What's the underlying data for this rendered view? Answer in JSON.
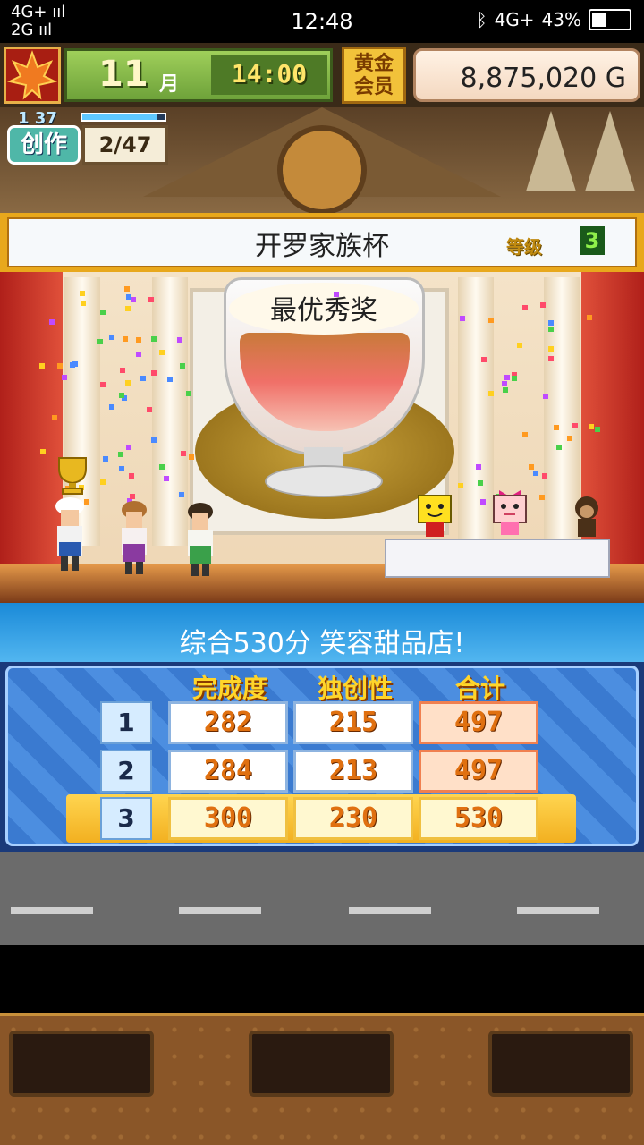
{
  "status_bar": {
    "network_line1": "4G+ ııl",
    "network_line2": "2G ııl",
    "time": "12:48",
    "bluetooth": "bluetooth-icon",
    "network_right": "4G+",
    "battery": "43%",
    "battery_level": 0.43
  },
  "hud": {
    "month": "11",
    "month_unit": "月",
    "clock": "14:00",
    "vip_line1": "黄金",
    "vip_line2": "会员",
    "money": "8,875,020 G",
    "season_icon": "maple-leaf-icon"
  },
  "creation": {
    "level_text": "1 37",
    "label": "创作",
    "count": "2/47",
    "progress": 0.9
  },
  "contest": {
    "title": "开罗家族杯",
    "level_label": "等级",
    "level_value": "3",
    "award": "最优秀奖"
  },
  "result": {
    "text": "综合530分 笑容甜品店!"
  },
  "scoreboard": {
    "headers": [
      "完成度",
      "独创性",
      "合计"
    ],
    "rows": [
      {
        "rank": "1",
        "completion": "282",
        "originality": "215",
        "total": "497"
      },
      {
        "rank": "2",
        "completion": "284",
        "originality": "213",
        "total": "497"
      },
      {
        "rank": "3",
        "completion": "300",
        "originality": "230",
        "total": "530"
      }
    ]
  },
  "colors": {
    "accent_blue": "#1a8ad8",
    "gold": "#e8a81c",
    "score_orange": "#e07010"
  }
}
